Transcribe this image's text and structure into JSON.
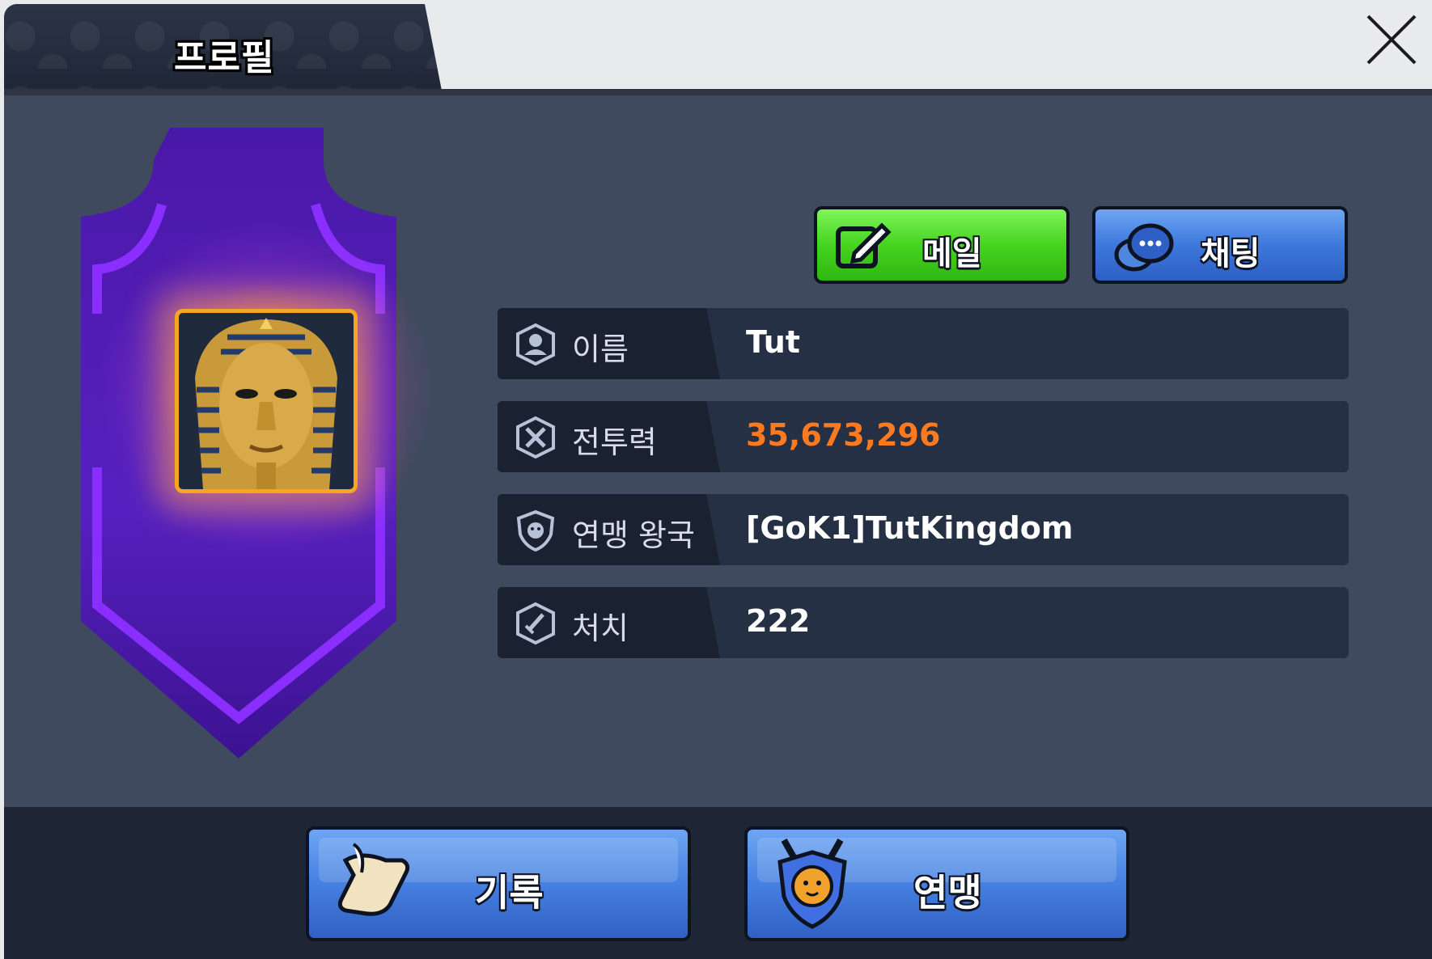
{
  "header": {
    "tab_title": "프로필"
  },
  "actions": {
    "mail_label": "메일",
    "chat_label": "채팅"
  },
  "profile": {
    "rows": [
      {
        "icon": "user-icon",
        "label": "이름",
        "value": "Tut"
      },
      {
        "icon": "power-icon",
        "label": "전투력",
        "value": "35,673,296"
      },
      {
        "icon": "alliance-shield-icon",
        "label": "연맹 왕국",
        "value": "[GoK1]TutKingdom"
      },
      {
        "icon": "sword-icon",
        "label": "처치",
        "value": "222"
      }
    ]
  },
  "footer": {
    "record_label": "기록",
    "alliance_label": "연맹"
  },
  "colors": {
    "power_value": "#ff7a1f",
    "mail_button": "#46d41f",
    "chat_button": "#3d78dd",
    "banner": "#5b1fc9"
  }
}
